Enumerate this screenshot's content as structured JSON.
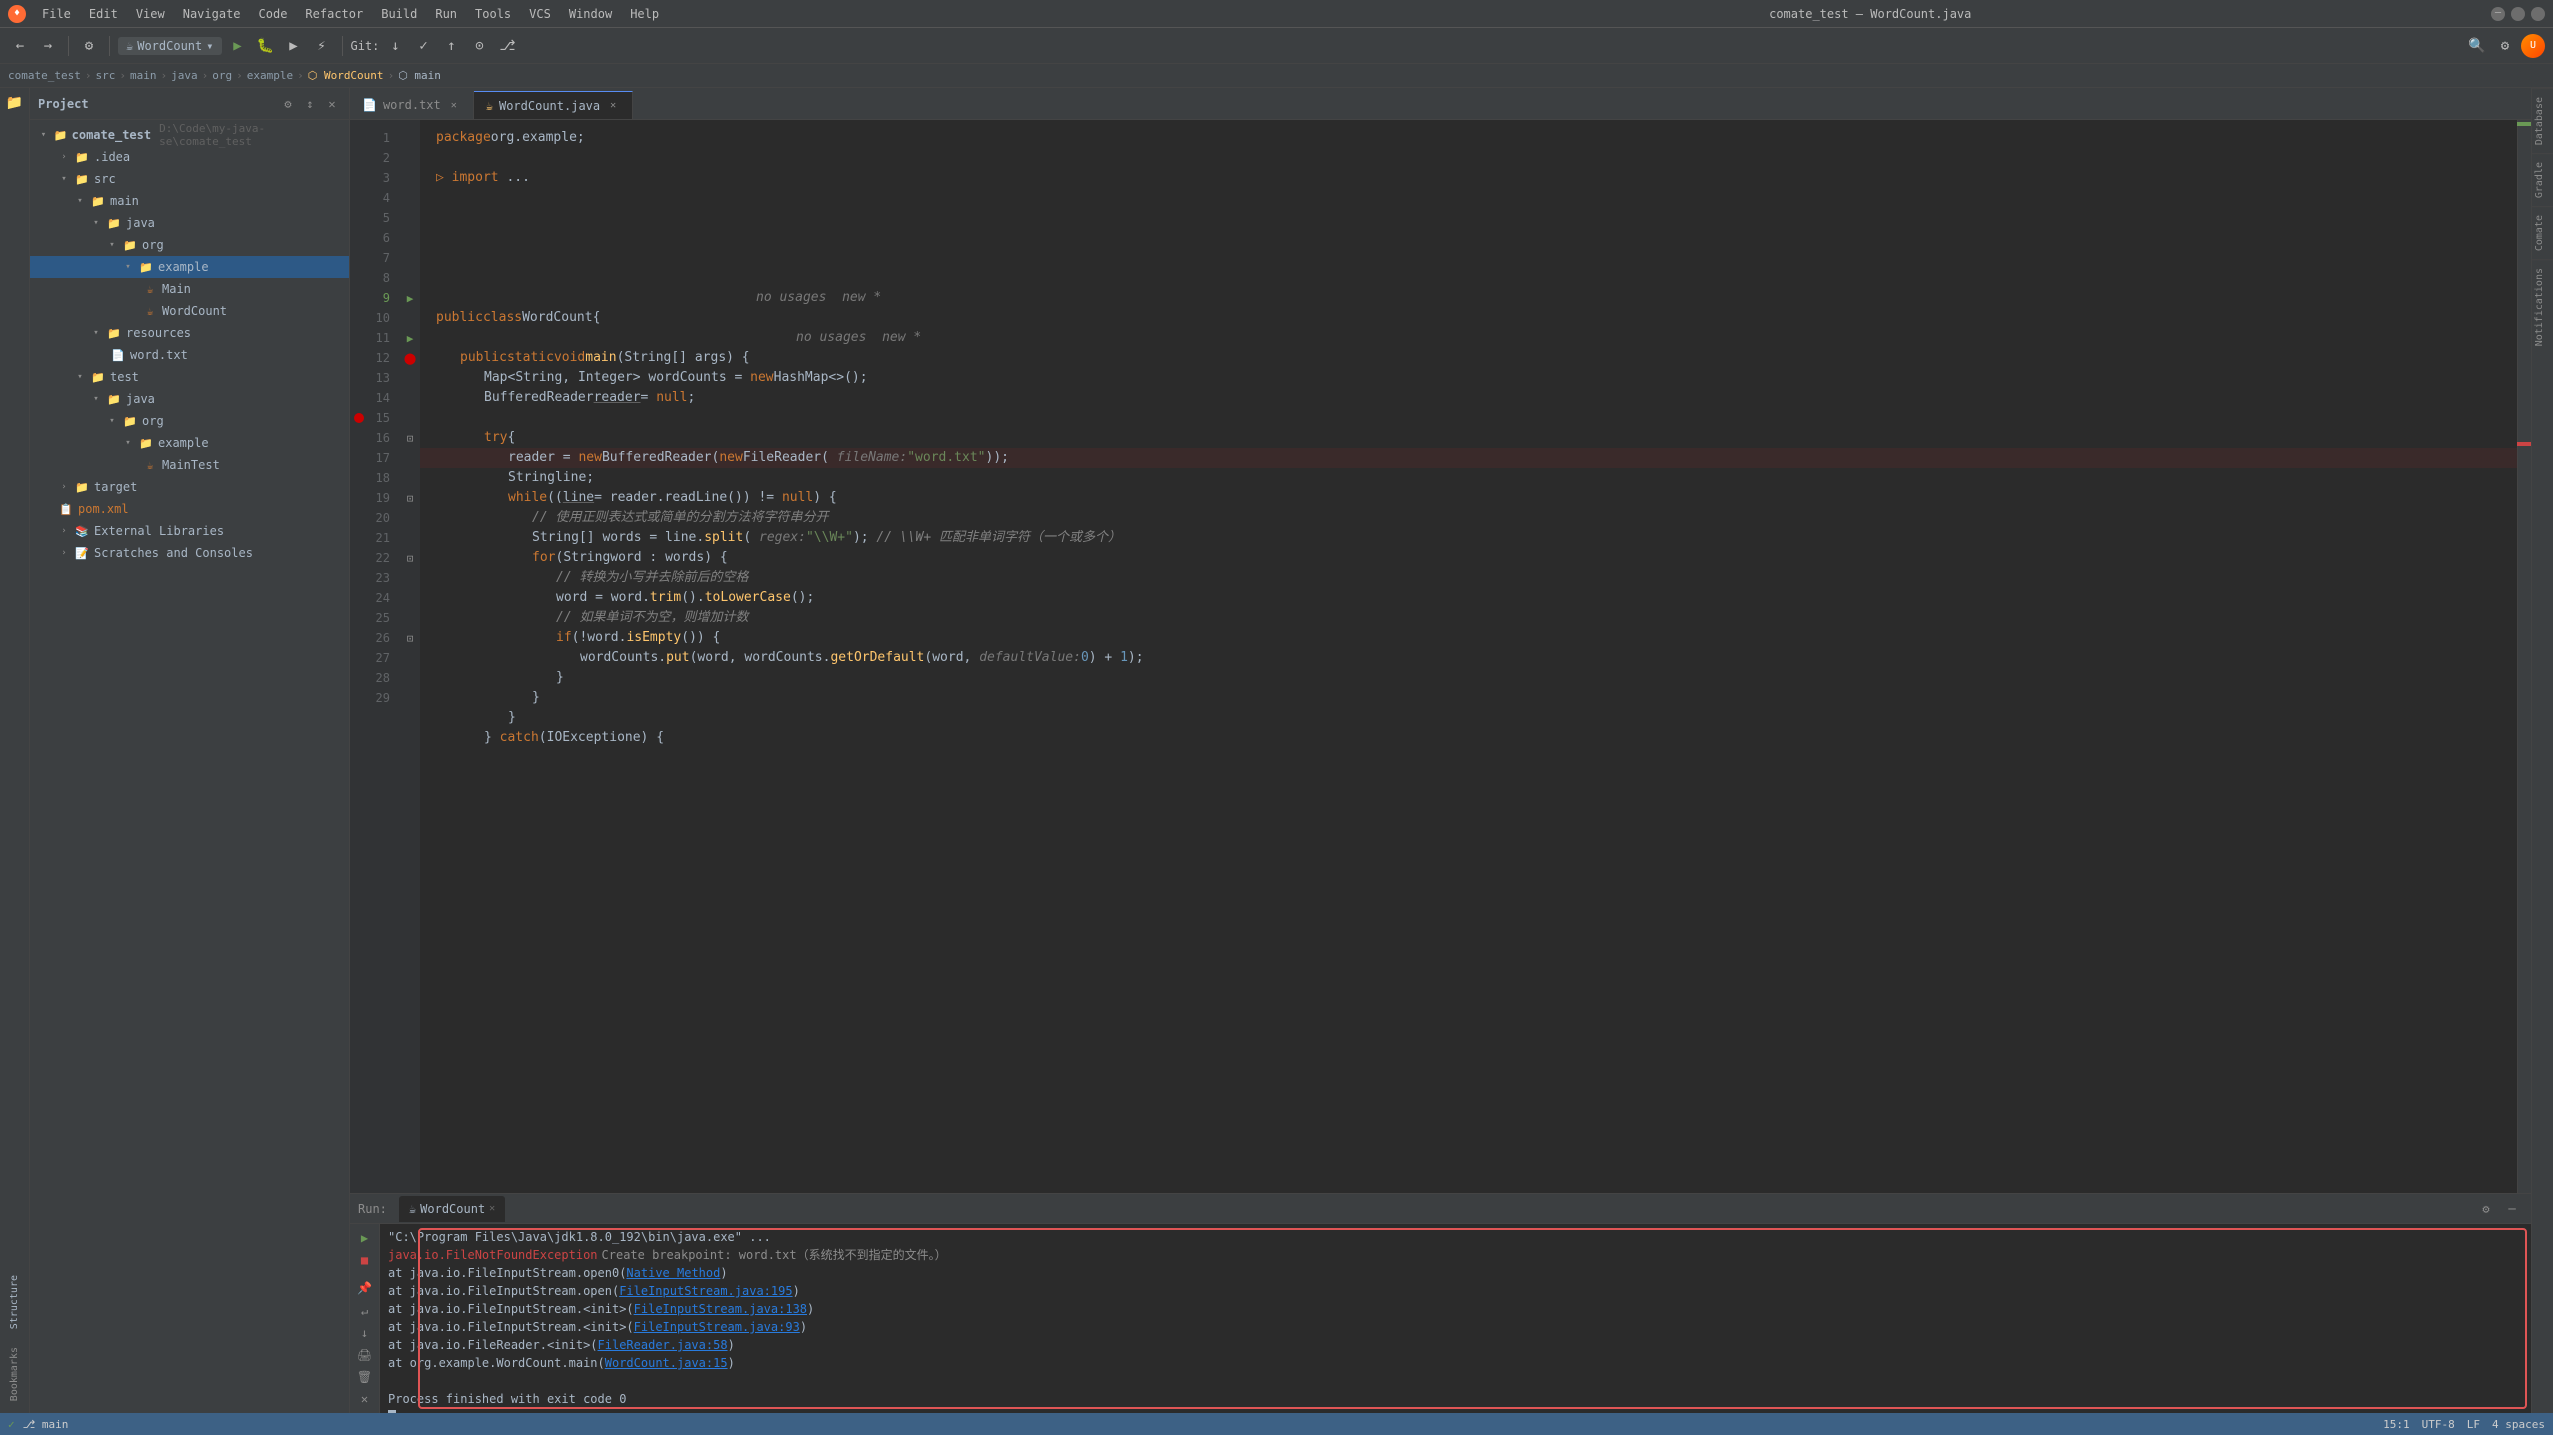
{
  "app": {
    "title": "comate_test – WordCount.java",
    "logo": "♦"
  },
  "titlebar": {
    "menus": [
      "File",
      "Edit",
      "View",
      "Navigate",
      "Code",
      "Refactor",
      "Build",
      "Run",
      "Tools",
      "VCS",
      "Window",
      "Help"
    ],
    "window_title": "comate_test – WordCount.java",
    "min": "─",
    "max": "□",
    "close": "✕"
  },
  "toolbar": {
    "run_config": "WordCount",
    "git_label": "Git:"
  },
  "breadcrumb": {
    "items": [
      "comate_test",
      "src",
      "main",
      "java",
      "org",
      "example",
      "WordCount",
      "main"
    ]
  },
  "sidebar": {
    "title": "Project",
    "root": "comate_test",
    "root_path": "D:\\Code\\my-java-se\\comate_test",
    "tree": [
      {
        "id": "idea",
        "label": ".idea",
        "level": 1,
        "type": "folder",
        "expanded": false
      },
      {
        "id": "src",
        "label": "src",
        "level": 1,
        "type": "folder",
        "expanded": true
      },
      {
        "id": "main",
        "label": "main",
        "level": 2,
        "type": "folder",
        "expanded": true
      },
      {
        "id": "java",
        "label": "java",
        "level": 3,
        "type": "folder",
        "expanded": true
      },
      {
        "id": "org",
        "label": "org",
        "level": 4,
        "type": "folder",
        "expanded": true
      },
      {
        "id": "example",
        "label": "example",
        "level": 5,
        "type": "folder",
        "expanded": true,
        "selected": true
      },
      {
        "id": "Main",
        "label": "Main",
        "level": 6,
        "type": "java",
        "expanded": false
      },
      {
        "id": "WordCount",
        "label": "WordCount",
        "level": 6,
        "type": "java",
        "expanded": false
      },
      {
        "id": "resources",
        "label": "resources",
        "level": 3,
        "type": "folder",
        "expanded": true
      },
      {
        "id": "word_txt",
        "label": "word.txt",
        "level": 4,
        "type": "txt",
        "expanded": false
      },
      {
        "id": "test",
        "label": "test",
        "level": 2,
        "type": "folder",
        "expanded": true
      },
      {
        "id": "java2",
        "label": "java",
        "level": 3,
        "type": "folder",
        "expanded": true
      },
      {
        "id": "org2",
        "label": "org",
        "level": 4,
        "type": "folder",
        "expanded": true
      },
      {
        "id": "example2",
        "label": "example",
        "level": 5,
        "type": "folder",
        "expanded": true
      },
      {
        "id": "MainTest",
        "label": "MainTest",
        "level": 6,
        "type": "java",
        "expanded": false
      },
      {
        "id": "target",
        "label": "target",
        "level": 1,
        "type": "folder",
        "expanded": false
      },
      {
        "id": "pom_xml",
        "label": "pom.xml",
        "level": 1,
        "type": "xml",
        "expanded": false
      },
      {
        "id": "ext_libs",
        "label": "External Libraries",
        "level": 1,
        "type": "folder",
        "expanded": false
      },
      {
        "id": "scratches",
        "label": "Scratches and Consoles",
        "level": 1,
        "type": "folder",
        "expanded": false
      }
    ]
  },
  "editor": {
    "tabs": [
      {
        "id": "word_txt_tab",
        "label": "word.txt",
        "icon": "📄",
        "active": false
      },
      {
        "id": "wordcount_tab",
        "label": "WordCount.java",
        "icon": "☕",
        "active": true
      }
    ],
    "lines": [
      {
        "num": 1,
        "code": "package org.example;",
        "tokens": [
          {
            "t": "kw",
            "v": "package"
          },
          {
            "t": "normal",
            "v": " org.example;"
          }
        ]
      },
      {
        "num": 2,
        "code": "",
        "tokens": []
      },
      {
        "num": 3,
        "code": "import ...;",
        "tokens": [
          {
            "t": "kw",
            "v": "import"
          },
          {
            "t": "normal",
            "v": " ..."
          }
        ]
      },
      {
        "num": 8,
        "code": "",
        "tokens": []
      },
      {
        "num": 9,
        "code": "    no usages  new *",
        "tokens": [
          {
            "t": "hint",
            "v": "    no usages  new *"
          }
        ]
      },
      {
        "num": 9,
        "code": "public class WordCount {",
        "tokens": [
          {
            "t": "kw",
            "v": "public"
          },
          {
            "t": "normal",
            "v": " "
          },
          {
            "t": "kw",
            "v": "class"
          },
          {
            "t": "normal",
            "v": " "
          },
          {
            "t": "cls",
            "v": "WordCount"
          },
          {
            "t": "normal",
            "v": " {"
          }
        ]
      },
      {
        "num": 10,
        "code": "    no usages  new *",
        "tokens": [
          {
            "t": "hint",
            "v": "    no usages  new *"
          }
        ]
      },
      {
        "num": 10,
        "code": "    public static void main(String[] args) {",
        "tokens": [
          {
            "t": "kw",
            "v": "    public"
          },
          {
            "t": "normal",
            "v": " "
          },
          {
            "t": "kw",
            "v": "static"
          },
          {
            "t": "normal",
            "v": " "
          },
          {
            "t": "kw",
            "v": "void"
          },
          {
            "t": "normal",
            "v": " "
          },
          {
            "t": "fn",
            "v": "main"
          },
          {
            "t": "normal",
            "v": "("
          },
          {
            "t": "cls",
            "v": "String"
          },
          {
            "t": "normal",
            "v": "[] args) {"
          }
        ]
      },
      {
        "num": 11,
        "code": "        Map<String, Integer> wordCounts = new HashMap<>();",
        "tokens": [
          {
            "t": "cls",
            "v": "        Map"
          },
          {
            "t": "normal",
            "v": "<"
          },
          {
            "t": "cls",
            "v": "String"
          },
          {
            "t": "normal",
            "v": ", "
          },
          {
            "t": "cls",
            "v": "Integer"
          },
          {
            "t": "normal",
            "v": "> wordCounts = "
          },
          {
            "t": "kw",
            "v": "new"
          },
          {
            "t": "normal",
            "v": " "
          },
          {
            "t": "cls",
            "v": "HashMap"
          },
          {
            "t": "normal",
            "v": "<>();"
          }
        ]
      },
      {
        "num": 12,
        "code": "        BufferedReader reader = null;",
        "tokens": [
          {
            "t": "cls",
            "v": "        BufferedReader"
          },
          {
            "t": "normal",
            "v": " "
          },
          {
            "t": "var-underline",
            "v": "reader"
          },
          {
            "t": "normal",
            "v": " = "
          },
          {
            "t": "kw",
            "v": "null"
          },
          {
            "t": "normal",
            "v": ";"
          }
        ]
      },
      {
        "num": 13,
        "code": "",
        "tokens": []
      },
      {
        "num": 14,
        "code": "        try {",
        "tokens": [
          {
            "t": "kw",
            "v": "        try"
          },
          {
            "t": "normal",
            "v": " {"
          }
        ]
      },
      {
        "num": 15,
        "code": "            reader = new BufferedReader(new FileReader( fileName: \"word.txt\"));",
        "tokens": [
          {
            "t": "normal",
            "v": "            reader = "
          },
          {
            "t": "kw",
            "v": "new"
          },
          {
            "t": "normal",
            "v": " "
          },
          {
            "t": "cls",
            "v": "BufferedReader"
          },
          {
            "t": "normal",
            "v": "("
          },
          {
            "t": "kw",
            "v": "new"
          },
          {
            "t": "normal",
            "v": " "
          },
          {
            "t": "cls",
            "v": "FileReader"
          },
          {
            "t": "normal",
            "v": "( "
          },
          {
            "t": "hint",
            "v": "fileName:"
          },
          {
            "t": "normal",
            "v": " "
          },
          {
            "t": "str",
            "v": "\"word.txt\""
          },
          {
            "t": "normal",
            "v": "));"
          }
        ]
      },
      {
        "num": 16,
        "code": "            String line;",
        "tokens": [
          {
            "t": "cls",
            "v": "            String"
          },
          {
            "t": "normal",
            "v": " line;"
          }
        ]
      },
      {
        "num": 17,
        "code": "            while ((line = reader.readLine()) != null) {",
        "tokens": [
          {
            "t": "kw",
            "v": "            while"
          },
          {
            "t": "normal",
            "v": " (("
          },
          {
            "t": "var-underline",
            "v": "line"
          },
          {
            "t": "normal",
            "v": " = reader.readLine()) != "
          },
          {
            "t": "kw",
            "v": "null"
          },
          {
            "t": "normal",
            "v": ") {"
          }
        ]
      },
      {
        "num": 18,
        "code": "                // 使用正则表达式或简单的分割方法将字符串分开",
        "tokens": [
          {
            "t": "cm",
            "v": "                // 使用正则表达式或简单的分割方法将字符串分开"
          }
        ]
      },
      {
        "num": 19,
        "code": "                String[] words = line.split( regex: \"\\\\W+\"); // \\\\W+ 匹配非单词字符（一个或多个）",
        "tokens": [
          {
            "t": "cls",
            "v": "                String"
          },
          {
            "t": "normal",
            "v": "[] words = line."
          },
          {
            "t": "fn",
            "v": "split"
          },
          {
            "t": "normal",
            "v": "( "
          },
          {
            "t": "hint",
            "v": "regex:"
          },
          {
            "t": "normal",
            "v": " "
          },
          {
            "t": "str",
            "v": "\"\\\\W+\""
          },
          {
            "t": "normal",
            "v": "); "
          },
          {
            "t": "cm",
            "v": "// \\\\W+ 匹配非单词字符（一个或多个）"
          }
        ]
      },
      {
        "num": 20,
        "code": "                for (String word : words) {",
        "tokens": [
          {
            "t": "kw",
            "v": "                for"
          },
          {
            "t": "normal",
            "v": " ("
          },
          {
            "t": "cls",
            "v": "String"
          },
          {
            "t": "normal",
            "v": " word : words) {"
          }
        ]
      },
      {
        "num": 21,
        "code": "                    // 转换为小写并去除前后的空格",
        "tokens": [
          {
            "t": "cm",
            "v": "                    // 转换为小写并去除前后的空格"
          }
        ]
      },
      {
        "num": 22,
        "code": "                    word = word.trim().toLowerCase();",
        "tokens": [
          {
            "t": "normal",
            "v": "                    word = word."
          },
          {
            "t": "fn",
            "v": "trim"
          },
          {
            "t": "normal",
            "v": "()."
          },
          {
            "t": "fn",
            "v": "toLowerCase"
          },
          {
            "t": "normal",
            "v": "();"
          }
        ]
      },
      {
        "num": 23,
        "code": "                    // 如果单词不为空，则增加计数",
        "tokens": [
          {
            "t": "cm",
            "v": "                    // 如果单词不为空，则增加计数"
          }
        ]
      },
      {
        "num": 24,
        "code": "                    if (!word.isEmpty()) {",
        "tokens": [
          {
            "t": "kw",
            "v": "                    if"
          },
          {
            "t": "normal",
            "v": " (!word."
          },
          {
            "t": "fn",
            "v": "isEmpty"
          },
          {
            "t": "normal",
            "v": "()) {"
          }
        ]
      },
      {
        "num": 25,
        "code": "                        wordCounts.put(word, wordCounts.getOrDefault(word,  defaultValue: 0) + 1);",
        "tokens": [
          {
            "t": "normal",
            "v": "                        wordCounts."
          },
          {
            "t": "fn",
            "v": "put"
          },
          {
            "t": "normal",
            "v": "(word, wordCounts."
          },
          {
            "t": "fn",
            "v": "getOrDefault"
          },
          {
            "t": "normal",
            "v": "(word, "
          },
          {
            "t": "hint",
            "v": "defaultValue:"
          },
          {
            "t": "normal",
            "v": " "
          },
          {
            "t": "num",
            "v": "0"
          },
          {
            "t": "normal",
            "v": ") + "
          },
          {
            "t": "num",
            "v": "1"
          },
          {
            "t": "normal",
            "v": ");"
          }
        ]
      },
      {
        "num": 26,
        "code": "                    }",
        "tokens": [
          {
            "t": "normal",
            "v": "                    }"
          }
        ]
      },
      {
        "num": 27,
        "code": "                }",
        "tokens": [
          {
            "t": "normal",
            "v": "                }"
          }
        ]
      },
      {
        "num": 28,
        "code": "            }",
        "tokens": [
          {
            "t": "normal",
            "v": "            }"
          }
        ]
      },
      {
        "num": 29,
        "code": "        } catch (IOException e) {",
        "tokens": [
          {
            "t": "normal",
            "v": "        } "
          },
          {
            "t": "kw",
            "v": "catch"
          },
          {
            "t": "normal",
            "v": " ("
          },
          {
            "t": "cls",
            "v": "IOException"
          },
          {
            "t": "normal",
            "v": " e) {"
          }
        ]
      }
    ]
  },
  "run_panel": {
    "tab_label": "WordCount",
    "output_lines": [
      {
        "id": "cmd_line",
        "text": "\"C:\\Program Files\\Java\\jdk1.8.0_192\\bin\\java.exe\" ...",
        "type": "normal"
      },
      {
        "id": "exception_line",
        "text": "java.io.FileNotFoundException",
        "type": "error",
        "suffix": " Create breakpoint : word.txt（系统找不到指定的文件。）"
      },
      {
        "id": "stack1",
        "text": "\tat java.io.FileInputStream.open0(Native Method)",
        "type": "normal",
        "link_start": 31,
        "link_end": 60
      },
      {
        "id": "stack2",
        "text": "\tat java.io.FileInputStream.open(FileInputStream.java:195)",
        "type": "normal",
        "link": "FileInputStream.java:195"
      },
      {
        "id": "stack3",
        "text": "\tat java.io.FileInputStream.<init>(FileInputStream.java:138)",
        "type": "normal",
        "link": "FileInputStream.java:138"
      },
      {
        "id": "stack4",
        "text": "\tat java.io.FileInputStream.<init>(FileInputStream.java:93)",
        "type": "normal",
        "link": "FileInputStream.java:93"
      },
      {
        "id": "stack5",
        "text": "\tat java.io.FileReader.<init>(FileReader.java:58)",
        "type": "normal",
        "link": "FileReader.java:58"
      },
      {
        "id": "stack6",
        "text": "\tat org.example.WordCount.main(WordCount.java:15)",
        "type": "normal",
        "link": "WordCount.java:15"
      },
      {
        "id": "finish",
        "text": "Process finished with exit code 0",
        "type": "success"
      }
    ]
  },
  "status_bar": {
    "left": "✓",
    "git": "main",
    "encoding": "UTF-8",
    "line_sep": "LF",
    "position": "15:1",
    "indent": "4 spaces"
  },
  "right_sidebar_tabs": [
    "Database",
    "Gradle",
    "Comate",
    "Notifications"
  ],
  "left_sidebar_tabs": [
    "Project",
    "Structure",
    "Bookmarks"
  ]
}
